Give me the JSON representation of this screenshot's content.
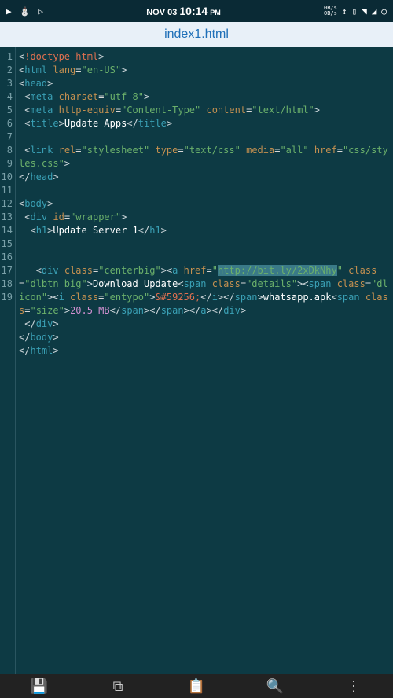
{
  "statusbar": {
    "date": "NOV 03",
    "time": "10:14",
    "ampm": "PM",
    "speed_top": "0B/s",
    "speed_bot": "0B/s"
  },
  "titlebar": {
    "filename": "index1.html"
  },
  "code": {
    "lines": [
      "1",
      "2",
      "3",
      "4",
      "5",
      "6",
      "7",
      "8",
      "9",
      "10",
      "11",
      "12",
      "13",
      "14",
      "15",
      "16",
      "17",
      "18",
      "19"
    ],
    "l1": {
      "doctype": "!doctype html"
    },
    "l2": {
      "tag": "html",
      "attr": "lang",
      "val": "\"en-US\""
    },
    "l3": {
      "tag": "head"
    },
    "l4": {
      "tag": "meta",
      "attr": "charset",
      "val": "\"utf-8\""
    },
    "l5": {
      "tag": "meta",
      "a1": "http-equiv",
      "v1": "\"Content-Type\"",
      "a2": "content",
      "v2": "\"text/html\""
    },
    "l6": {
      "open": "title",
      "text": "Update Apps",
      "close": "title"
    },
    "l8": {
      "tag": "link",
      "a1": "rel",
      "v1": "\"stylesheet\"",
      "a2": "type",
      "v2": "\"text/css\"",
      "a3": "media",
      "v3": "\"all\"",
      "a4": "href",
      "v4_a": "\"css/",
      "v4_b": "styles.css\""
    },
    "l9": {
      "tag": "head"
    },
    "l11": {
      "tag": "body"
    },
    "l12": {
      "tag": "div",
      "attr": "id",
      "val": "\"wrapper\""
    },
    "l13": {
      "open": "h1",
      "text": "Update Server 1",
      "close": "h1"
    },
    "l16": {
      "div_tag": "div",
      "div_attr": "class",
      "div_val": "\"centerbig\"",
      "a_tag": "a",
      "a_attr": "href",
      "a_url_q": "\"",
      "a_url": "http://bit.ly/2xDkNhy",
      "a_url_q2": "\"",
      "cls_attr": "class",
      "dlbtn_val": "\"dlbtn big\"",
      "dl_text": "Download Update",
      "span": "span",
      "details_val": "\"details\"",
      "span2": "span",
      "dlicon_val": "\"dlicon\"",
      "i_tag": "i",
      "entypo_val": "\"entypo\"",
      "entity": "&#59256;",
      "i_close": "i",
      "span_close": "span",
      "wa_text": "whatsapp.apk",
      "size_val": "\"size\"",
      "mb": "20.5 MB",
      "a_close": "a",
      "div_close": "div"
    },
    "l17": {
      "tag": "div"
    },
    "l18": {
      "tag": "body"
    },
    "l19": {
      "tag": "html"
    }
  },
  "bottombar": {
    "save": "💾",
    "copy": "⧉",
    "paste": "📋",
    "search": "🔍",
    "more": "⋮"
  }
}
